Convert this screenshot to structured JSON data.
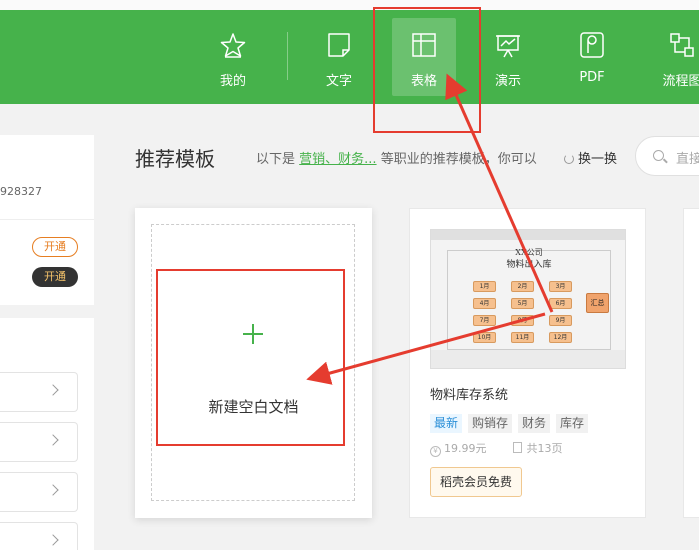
{
  "nav": {
    "items": [
      {
        "id": "mine",
        "label": "我的",
        "icon": "star-icon"
      },
      {
        "id": "text",
        "label": "文字",
        "icon": "document-icon"
      },
      {
        "id": "sheet",
        "label": "表格",
        "icon": "table-icon"
      },
      {
        "id": "present",
        "label": "演示",
        "icon": "presentation-icon"
      },
      {
        "id": "pdf",
        "label": "PDF",
        "icon": "pdf-icon"
      },
      {
        "id": "flow",
        "label": "流程图",
        "icon": "flowchart-icon"
      }
    ],
    "active": "表格"
  },
  "sidebar": {
    "account_number": "928327",
    "open_label": "开通",
    "vip_open_label": "开通"
  },
  "main": {
    "section_title": "推荐模板",
    "subline_prefix": "以下是",
    "subline_links": "营销、财务...",
    "subline_suffix": "等职业的推荐模板，你可以",
    "refresh_label": "换一换",
    "search_placeholder": "直接"
  },
  "new_card": {
    "label": "新建空白文档"
  },
  "template_card": {
    "thumbnail": {
      "company": "XX公司",
      "heading": "物料出入库",
      "months": [
        "1月",
        "2月",
        "3月",
        "4月",
        "5月",
        "6月",
        "7月",
        "8月",
        "9月",
        "10月",
        "11月",
        "12月"
      ],
      "summary": "汇总"
    },
    "title": "物料库存系统",
    "tags": [
      {
        "label": "最新",
        "kind": "new"
      },
      {
        "label": "购销存",
        "kind": "normal"
      },
      {
        "label": "财务",
        "kind": "normal"
      },
      {
        "label": "库存",
        "kind": "normal"
      }
    ],
    "price": "19.99元",
    "pages": "共13页",
    "vip_label": "稻壳会员免费"
  },
  "colors": {
    "brand_green": "#46b24b",
    "annotation_red": "#e53c2f",
    "tag_new_blue": "#2a8fd8",
    "vip_orange": "#e67e22"
  }
}
